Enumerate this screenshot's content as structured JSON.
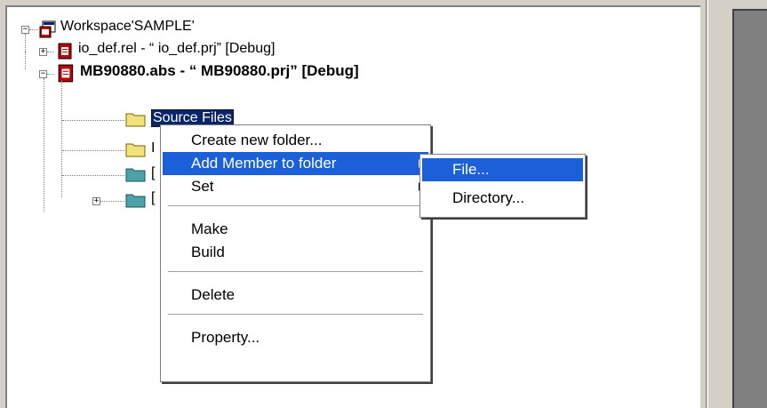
{
  "tree": {
    "workspace_label": "Workspace'SAMPLE'",
    "project1_label": "io_def.rel - “ io_def.prj”  [Debug]",
    "project2_label": "MB90880.abs - “ MB90880.prj”  [Debug]",
    "folder_source_label": "Source Files",
    "folder2_label": "I",
    "folder3_label": "[",
    "folder4_label": "["
  },
  "context_menu": {
    "items": [
      {
        "label": "Create new folder..."
      },
      {
        "label": "Add Member to folder"
      },
      {
        "label": "Set"
      },
      {
        "label": "Make"
      },
      {
        "label": "Build"
      },
      {
        "label": "Delete"
      },
      {
        "label": "Property..."
      }
    ]
  },
  "submenu": {
    "items": [
      {
        "label": "File..."
      },
      {
        "label": "Directory..."
      }
    ]
  },
  "icons": {
    "workspace": "workspace-icon",
    "project": "project-icon",
    "folder": "folder-icon"
  },
  "colors": {
    "highlight": "#1b60d8",
    "selection": "#0a246a",
    "folder_yellow": "#f2e27a",
    "folder_teal": "#4aa3a8",
    "project_red": "#c00000"
  }
}
